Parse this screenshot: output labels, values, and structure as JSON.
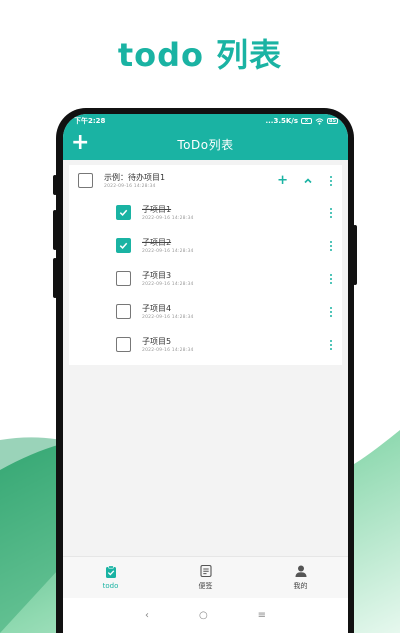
{
  "promo": {
    "title": "todo 列表"
  },
  "status_bar": {
    "time": "下午2:28",
    "net_speed": "...3.5K/s",
    "battery": "85"
  },
  "app_bar": {
    "add_icon": "plus-icon",
    "title": "ToDo列表"
  },
  "todo": {
    "parent": {
      "name": "示例：待办项目1",
      "time": "2022-09-16 14:28:34",
      "checked": false
    },
    "children": [
      {
        "name": "子项目1",
        "time": "2022-09-16 14:28:34",
        "checked": true
      },
      {
        "name": "子项目2",
        "time": "2022-09-16 14:28:34",
        "checked": true
      },
      {
        "name": "子项目3",
        "time": "2022-09-16 14:28:34",
        "checked": false
      },
      {
        "name": "子项目4",
        "time": "2022-09-16 14:28:34",
        "checked": false
      },
      {
        "name": "子项目5",
        "time": "2022-09-16 14:28:34",
        "checked": false
      }
    ]
  },
  "bottom_nav": {
    "items": [
      {
        "label": "todo",
        "icon": "clipboard-check-icon",
        "active": true
      },
      {
        "label": "便签",
        "icon": "note-icon",
        "active": false
      },
      {
        "label": "我的",
        "icon": "person-icon",
        "active": false
      }
    ]
  },
  "system_nav": {
    "back": "‹",
    "home": "○",
    "menu": "≡"
  },
  "colors": {
    "accent": "#1ab3a3",
    "wave_light": "#d8f3e6",
    "wave_dark": "#2fa578"
  }
}
